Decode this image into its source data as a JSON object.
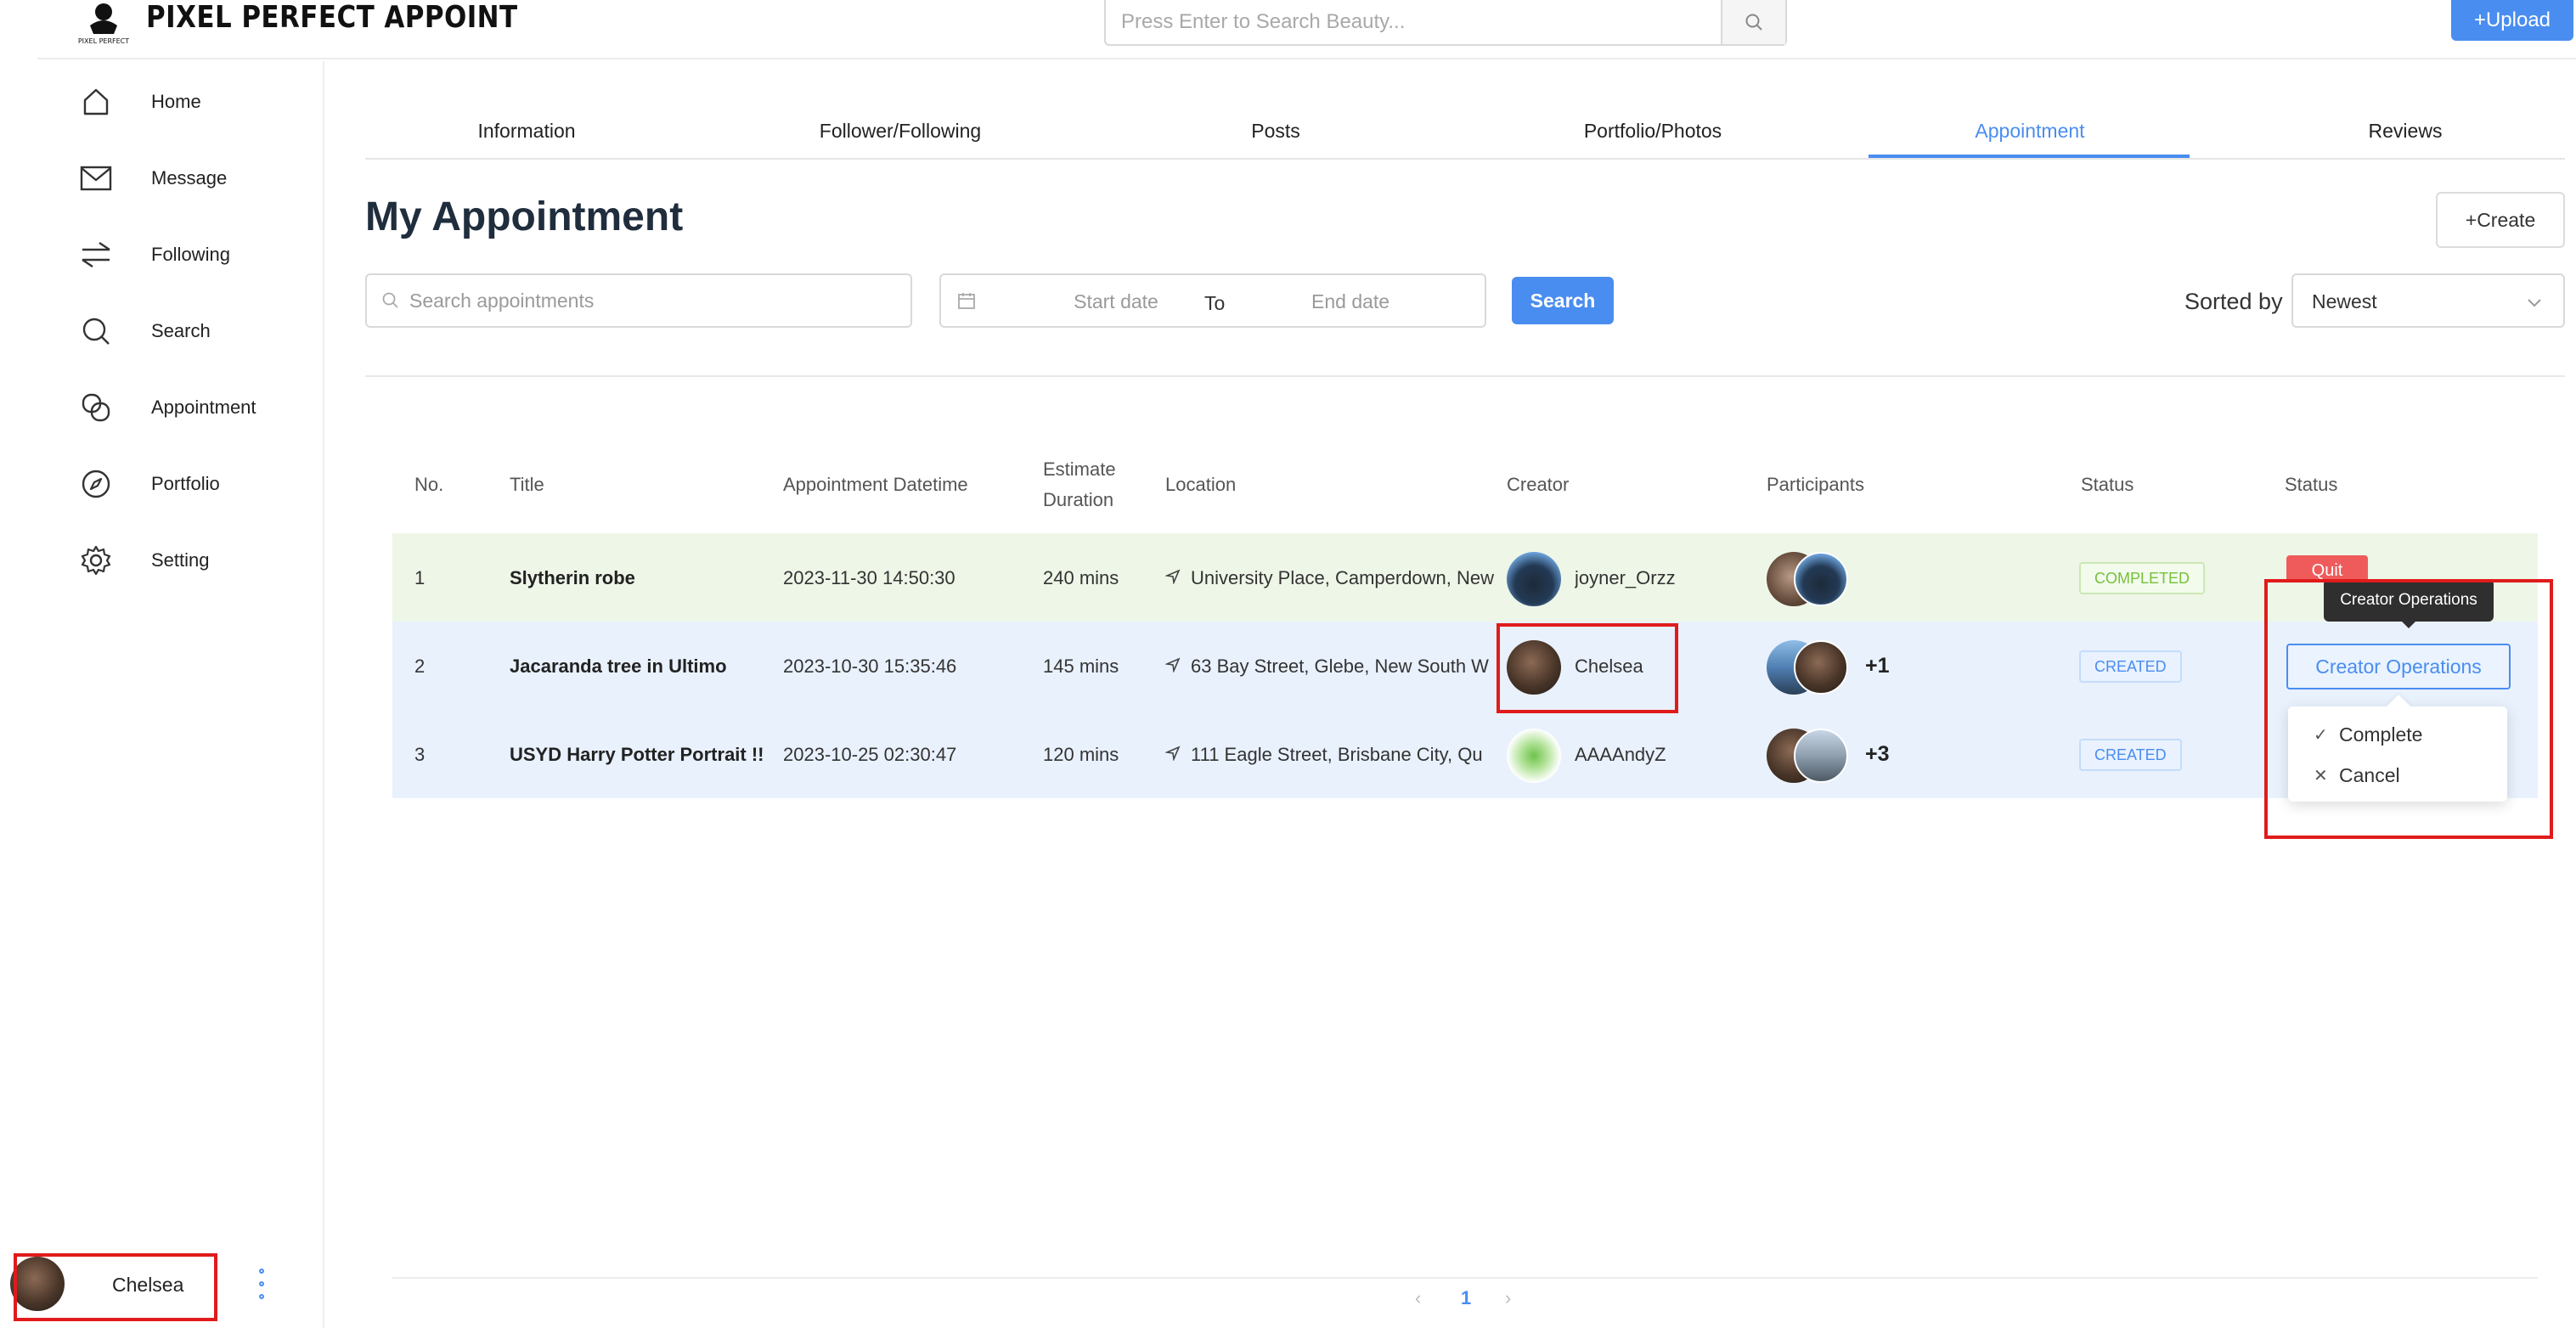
{
  "app": {
    "brand": "PIXEL PERFECT APPOINT",
    "logo_text": "PIXEL PERFECT",
    "search_placeholder": "Press Enter to Search Beauty...",
    "upload_label": "+Upload",
    "accent": "#4a8df0"
  },
  "sidebar": {
    "items": [
      {
        "label": "Home",
        "icon": "home-icon"
      },
      {
        "label": "Message",
        "icon": "envelope-icon"
      },
      {
        "label": "Following",
        "icon": "swap-arrows-icon"
      },
      {
        "label": "Search",
        "icon": "search-icon"
      },
      {
        "label": "Appointment",
        "icon": "link-icon"
      },
      {
        "label": "Portfolio",
        "icon": "compass-icon"
      },
      {
        "label": "Setting",
        "icon": "gear-icon"
      }
    ],
    "user": {
      "name": "Chelsea",
      "more_icon": "vertical-dots-icon"
    }
  },
  "tabs": [
    {
      "label": "Information"
    },
    {
      "label": "Follower/Following"
    },
    {
      "label": "Posts"
    },
    {
      "label": "Portfolio/Photos"
    },
    {
      "label": "Appointment",
      "active": true
    },
    {
      "label": "Reviews"
    }
  ],
  "page": {
    "title": "My Appointment",
    "create_label": "+Create",
    "search_placeholder": "Search appointments",
    "start_date_placeholder": "Start date",
    "to_label": "To",
    "end_date_placeholder": "End date",
    "search_button": "Search",
    "sorted_by_label": "Sorted by",
    "sort_value": "Newest"
  },
  "table": {
    "columns": {
      "no": "No.",
      "title": "Title",
      "datetime": "Appointment Datetime",
      "duration_1": "Estimate",
      "duration_2": "Duration",
      "location": "Location",
      "creator": "Creator",
      "participants": "Participants",
      "status": "Status",
      "ops": "Status"
    },
    "rows": [
      {
        "no": "1",
        "title": "Slytherin robe",
        "datetime": "2023-11-30 14:50:30",
        "duration": "240 mins",
        "location": "University Place, Camperdown, New",
        "creator": "joyner_Orzz",
        "participants_extra": "",
        "status": "COMPLETED"
      },
      {
        "no": "2",
        "title": "Jacaranda tree in Ultimo",
        "datetime": "2023-10-30 15:35:46",
        "duration": "145 mins",
        "location": "63 Bay Street, Glebe, New South W",
        "creator": "Chelsea",
        "participants_extra": "+1",
        "status": "CREATED"
      },
      {
        "no": "3",
        "title": "USYD Harry Potter Portrait !!",
        "datetime": "2023-10-25 02:30:47",
        "duration": "120 mins",
        "location": "111 Eagle Street, Brisbane City, Qu",
        "creator": "AAAAndyZ",
        "participants_extra": "+3",
        "status": "CREATED"
      }
    ],
    "ops": {
      "quit_label": "Quit",
      "tooltip": "Creator Operations",
      "button_label": "Creator Operations",
      "menu": [
        {
          "label": "Complete",
          "icon": "check-icon"
        },
        {
          "label": "Cancel",
          "icon": "close-icon"
        }
      ]
    }
  },
  "pagination": {
    "current": "1"
  }
}
